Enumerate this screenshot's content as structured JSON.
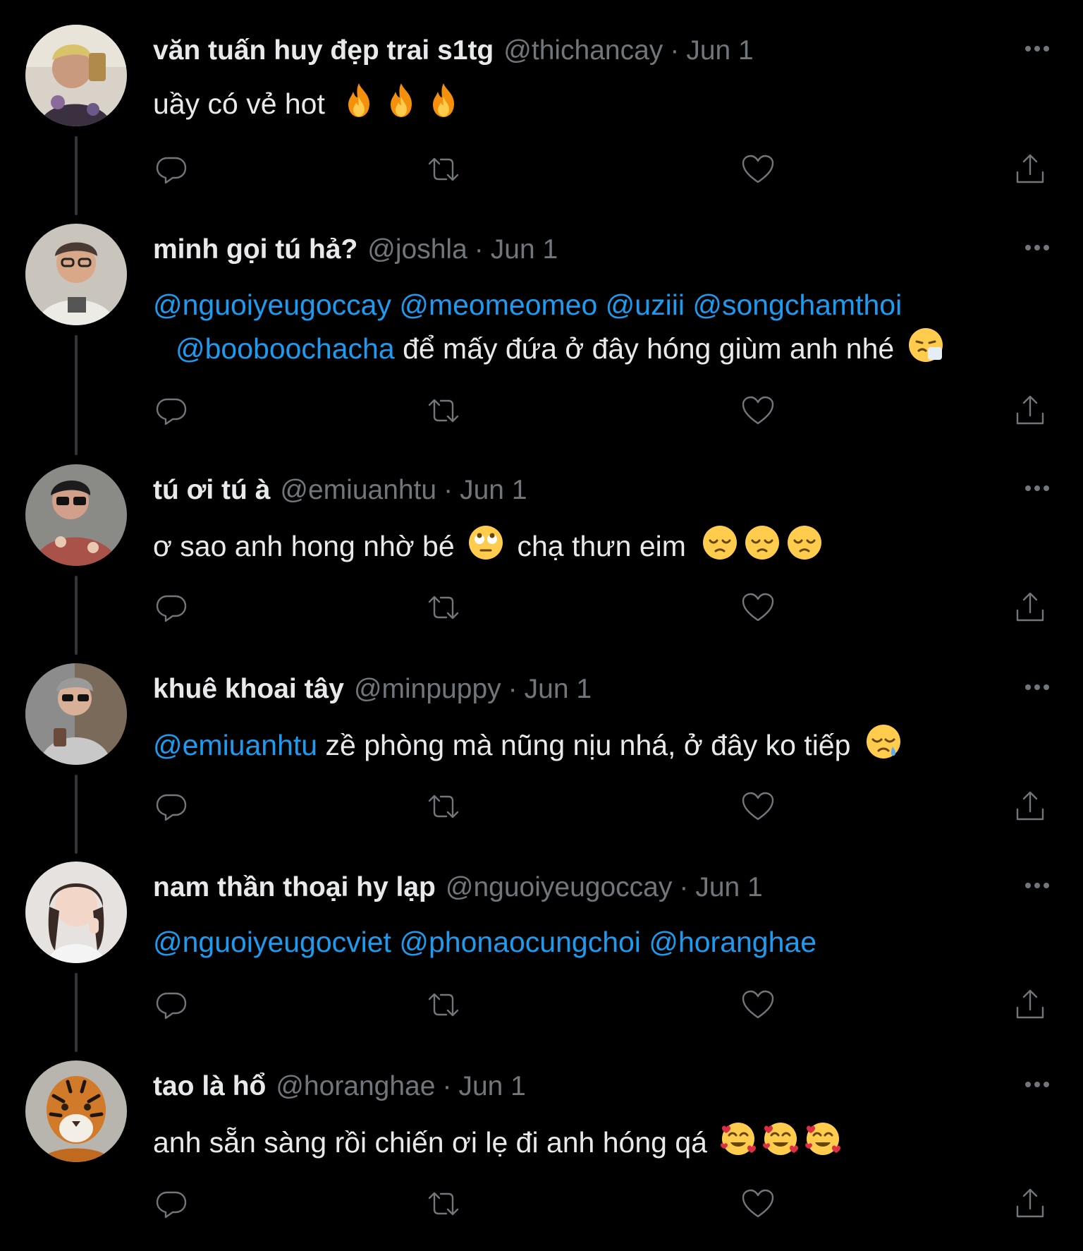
{
  "tweets": [
    {
      "name": "văn tuấn huy đẹp trai s1tg",
      "handle": "@thichancay",
      "date": "Jun 1",
      "text_before": "uầy có vẻ hot",
      "emojis": [
        "fire-emoji",
        "fire-emoji",
        "fire-emoji"
      ],
      "avatar": "avatar-photo"
    },
    {
      "name": "minh gọi tú hả?",
      "handle": "@joshla",
      "date": "Jun 1",
      "mentions_line1": [
        "@nguoiyeugoccay",
        "@meomeomeo",
        "@uziii",
        "@songchamthoi"
      ],
      "mention_line2": "@booboochacha",
      "text_after": "để mấy đứa ở đây hóng giùm anh nhé",
      "emojis": [
        "sneezing-face-emoji"
      ],
      "avatar": "avatar-photo"
    },
    {
      "name": "tú ơi tú à",
      "handle": "@emiuanhtu",
      "date": "Jun 1",
      "text_before": "ơ sao anh hong nhờ bé",
      "text_after": "chạ thưn eim",
      "emojis_mid": [
        "eye-roll-emoji"
      ],
      "emojis": [
        "pensive-face-emoji",
        "pensive-face-emoji",
        "pensive-face-emoji"
      ],
      "avatar": "avatar-photo"
    },
    {
      "name": "khuê khoai tây",
      "handle": "@minpuppy",
      "date": "Jun 1",
      "mention": "@emiuanhtu",
      "text_after": "zề phòng mà nũng nịu nhá, ở đây ko tiếp",
      "emojis": [
        "sleepy-face-emoji"
      ],
      "avatar": "avatar-photo"
    },
    {
      "name": "nam thần thoại hy lạp",
      "handle": "@nguoiyeugoccay",
      "date": "Jun 1",
      "mentions_line1": [
        "@nguoiyeugocviet",
        "@phonaocungchoi",
        "@horanghae"
      ],
      "avatar": "avatar-photo"
    },
    {
      "name": "tao là hổ",
      "handle": "@horanghae",
      "date": "Jun 1",
      "text_before": "anh sẵn sàng rồi chiến ơi lẹ đi anh hóng qá",
      "emojis": [
        "smiling-face-with-hearts-emoji",
        "smiling-face-with-hearts-emoji",
        "smiling-face-with-hearts-emoji"
      ],
      "avatar": "tiger-avatar"
    }
  ],
  "actions": [
    "reply-icon",
    "retweet-icon",
    "like-icon",
    "share-icon"
  ],
  "colors": {
    "background": "#000000",
    "text": "#e7e9ea",
    "secondary": "#71767b",
    "link": "#1d9bf0"
  }
}
